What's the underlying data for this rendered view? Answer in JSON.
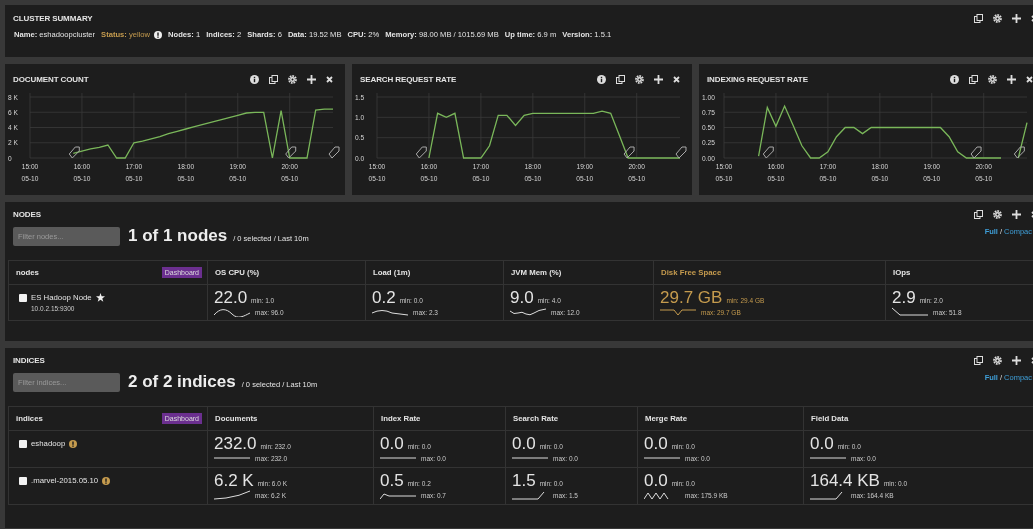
{
  "cluster_summary": {
    "title": "CLUSTER SUMMARY",
    "fields": [
      {
        "label": "Name:",
        "value": "eshadoopcluster"
      },
      {
        "label": "Status:",
        "value": "yellow",
        "color": "#c59b4e",
        "warning": true
      },
      {
        "label": "Nodes:",
        "value": "1"
      },
      {
        "label": "Indices:",
        "value": "2"
      },
      {
        "label": "Shards:",
        "value": "6"
      },
      {
        "label": "Data:",
        "value": "19.52 MB"
      },
      {
        "label": "CPU:",
        "value": "2%"
      },
      {
        "label": "Memory:",
        "value": "98.00 MB / 1015.69 MB"
      },
      {
        "label": "Up time:",
        "value": "6.9 m"
      },
      {
        "label": "Version:",
        "value": "1.5.1"
      }
    ]
  },
  "charts": [
    {
      "title": "DOCUMENT COUNT",
      "info": true,
      "chart_data": {
        "type": "line",
        "ylim": [
          0,
          8000
        ],
        "categories": [
          "15:00 05-10",
          null,
          null,
          null,
          null,
          null,
          "16:00 05-10",
          null,
          null,
          null,
          null,
          null,
          "17:00 05-10",
          null,
          null,
          null,
          null,
          null,
          "18:00 05-10",
          null,
          null,
          null,
          null,
          null,
          "19:00 05-10",
          null,
          null,
          null,
          null,
          null,
          "20:00 05-10",
          null,
          null,
          null,
          null,
          null
        ],
        "yticks": [
          {
            "value": 0,
            "label": "0"
          },
          {
            "value": 2000,
            "label": "2 K"
          },
          {
            "value": 4000,
            "label": "4 K"
          },
          {
            "value": 6000,
            "label": "6 K"
          },
          {
            "value": 8000,
            "label": "8 K"
          }
        ],
        "series": [
          {
            "color": "#7ab75a",
            "values": [
              null,
              null,
              null,
              null,
              null,
              600,
              900,
              1200,
              1400,
              1700,
              0,
              0,
              2000,
              2200,
              2500,
              2800,
              3200,
              3500,
              3800,
              4100,
              4400,
              4700,
              5000,
              5300,
              5600,
              5900,
              6000,
              6000,
              0,
              6200,
              0,
              0,
              0,
              6300,
              6400,
              6400
            ]
          }
        ],
        "grid": true
      }
    },
    {
      "title": "SEARCH REQUEST RATE",
      "info": true,
      "chart_data": {
        "type": "line",
        "ylim": [
          0,
          1.5
        ],
        "categories": [
          "15:00 05-10",
          null,
          null,
          null,
          null,
          null,
          "16:00 05-10",
          null,
          null,
          null,
          null,
          null,
          "17:00 05-10",
          null,
          null,
          null,
          null,
          null,
          "18:00 05-10",
          null,
          null,
          null,
          null,
          null,
          "19:00 05-10",
          null,
          null,
          null,
          null,
          null,
          "20:00 05-10",
          null,
          null,
          null,
          null,
          null
        ],
        "yticks": [
          {
            "value": 0,
            "label": "0.0"
          },
          {
            "value": 0.5,
            "label": "0.5"
          },
          {
            "value": 1,
            "label": "1.0"
          },
          {
            "value": 1.5,
            "label": "1.5"
          }
        ],
        "series": [
          {
            "color": "#7ab75a",
            "values": [
              null,
              null,
              null,
              null,
              null,
              null,
              0,
              1.1,
              1.0,
              1.1,
              0,
              0,
              0,
              0.3,
              1.05,
              1.05,
              0.8,
              1.05,
              1.1,
              1.1,
              1.1,
              1.1,
              1.1,
              1.1,
              1.1,
              1.1,
              1.15,
              1.1,
              0.55,
              0,
              0,
              0,
              0,
              0,
              0,
              0
            ]
          }
        ],
        "grid": true
      }
    },
    {
      "title": "INDEXING REQUEST RATE",
      "info": true,
      "chart_data": {
        "type": "line",
        "ylim": [
          0,
          1
        ],
        "categories": [
          "15:00 05-10",
          null,
          null,
          null,
          null,
          null,
          "16:00 05-10",
          null,
          null,
          null,
          null,
          null,
          "17:00 05-10",
          null,
          null,
          null,
          null,
          null,
          "18:00 05-10",
          null,
          null,
          null,
          null,
          null,
          "19:00 05-10",
          null,
          null,
          null,
          null,
          null,
          "20:00 05-10",
          null,
          null,
          null,
          null,
          null
        ],
        "yticks": [
          {
            "value": 0,
            "label": "0.00"
          },
          {
            "value": 0.25,
            "label": "0.25"
          },
          {
            "value": 0.5,
            "label": "0.50"
          },
          {
            "value": 0.75,
            "label": "0.75"
          },
          {
            "value": 1,
            "label": "1.00"
          }
        ],
        "series": [
          {
            "color": "#7ab75a",
            "values": [
              null,
              null,
              null,
              null,
              0.03,
              0.83,
              0.52,
              0.85,
              0.53,
              0.2,
              0,
              0,
              0.1,
              0.35,
              0.5,
              0.5,
              0.4,
              0.5,
              0.5,
              0.5,
              0.5,
              0.5,
              0.5,
              0.5,
              0.5,
              0.5,
              0.35,
              0.1,
              0,
              0,
              0,
              0,
              0,
              null,
              0,
              0.58
            ]
          }
        ],
        "grid": true
      }
    }
  ],
  "nodes": {
    "title": "NODES",
    "filter": {
      "placeholder": "Filter nodes..."
    },
    "count": "1 of 1 nodes",
    "summary": "/ 0 selected / Last 10m",
    "view_links": [
      {
        "label": "Full",
        "selected": true
      },
      {
        "label": "Compac",
        "selected": false
      }
    ],
    "view_separator": "/",
    "dashboard_button": "Dashboard",
    "columns": [
      {
        "label": "nodes",
        "alert": false
      },
      {
        "label": "OS CPU (%)",
        "alert": false
      },
      {
        "label": "Load (1m)",
        "alert": false
      },
      {
        "label": "JVM Mem (%)",
        "alert": false
      },
      {
        "label": "Disk Free Space",
        "alert": true
      },
      {
        "label": "IOps",
        "alert": false
      }
    ],
    "rows": [
      {
        "checked": false,
        "master": true,
        "cells": [
          {
            "kind": "name",
            "name": "ES Hadoop Node",
            "address": "10.0.2.15:9300"
          },
          {
            "kind": "metric",
            "value": "22.0",
            "min": "min: 1.0",
            "max": "max: 96.0"
          },
          {
            "kind": "metric",
            "value": "0.2",
            "min": "min: 0.0",
            "max": "max: 2.3"
          },
          {
            "kind": "metric",
            "value": "9.0",
            "min": "min: 4.0",
            "max": "max: 12.0"
          },
          {
            "kind": "metric",
            "value": "29.7 GB",
            "min": "min: 29.4 GB",
            "max": "max: 29.7 GB"
          },
          {
            "kind": "metric",
            "value": "2.9",
            "min": "min: 2.0",
            "max": "max: 51.8"
          }
        ]
      }
    ]
  },
  "indices": {
    "title": "INDICES",
    "filter": {
      "placeholder": "Filter indices..."
    },
    "count": "2 of 2 indices",
    "summary": "/ 0 selected / Last 10m",
    "view_links": [
      {
        "label": "Full",
        "selected": true
      },
      {
        "label": "Compac",
        "selected": false
      }
    ],
    "view_separator": "/",
    "dashboard_button": "Dashboard",
    "columns": [
      {
        "label": "indices",
        "alert": false
      },
      {
        "label": "Documents",
        "alert": false
      },
      {
        "label": "Index Rate",
        "alert": false
      },
      {
        "label": "Search Rate",
        "alert": false
      },
      {
        "label": "Merge Rate",
        "alert": false
      },
      {
        "label": "Field Data",
        "alert": false
      }
    ],
    "rows": [
      {
        "checked": false,
        "warning": true,
        "cells": [
          {
            "kind": "name",
            "name": "eshadoop"
          },
          {
            "kind": "metric",
            "value": "232.0",
            "min": "min: 232.0",
            "max": "max: 232.0"
          },
          {
            "kind": "metric",
            "value": "0.0",
            "min": "min: 0.0",
            "max": "max: 0.0"
          },
          {
            "kind": "metric",
            "value": "0.0",
            "min": "min: 0.0",
            "max": "max: 0.0"
          },
          {
            "kind": "metric",
            "value": "0.0",
            "min": "min: 0.0",
            "max": "max: 0.0"
          },
          {
            "kind": "metric",
            "value": "0.0",
            "min": "min: 0.0",
            "max": "max: 0.0"
          }
        ]
      },
      {
        "checked": false,
        "warning": true,
        "cells": [
          {
            "kind": "name",
            "name": ".marvel-2015.05.10"
          },
          {
            "kind": "metric",
            "value": "6.2 K",
            "min": "min: 6.0 K",
            "max": "max: 6.2 K"
          },
          {
            "kind": "metric",
            "value": "0.5",
            "min": "min: 0.2",
            "max": "max: 0.7"
          },
          {
            "kind": "metric",
            "value": "1.5",
            "min": "min: 0.0",
            "max": "max: 1.5"
          },
          {
            "kind": "metric",
            "value": "0.0",
            "min": "min: 0.0",
            "max": "max: 175.9 KB"
          },
          {
            "kind": "metric",
            "value": "164.4 KB",
            "min": "min: 0.0",
            "max": "max: 164.4 KB"
          }
        ]
      }
    ]
  }
}
